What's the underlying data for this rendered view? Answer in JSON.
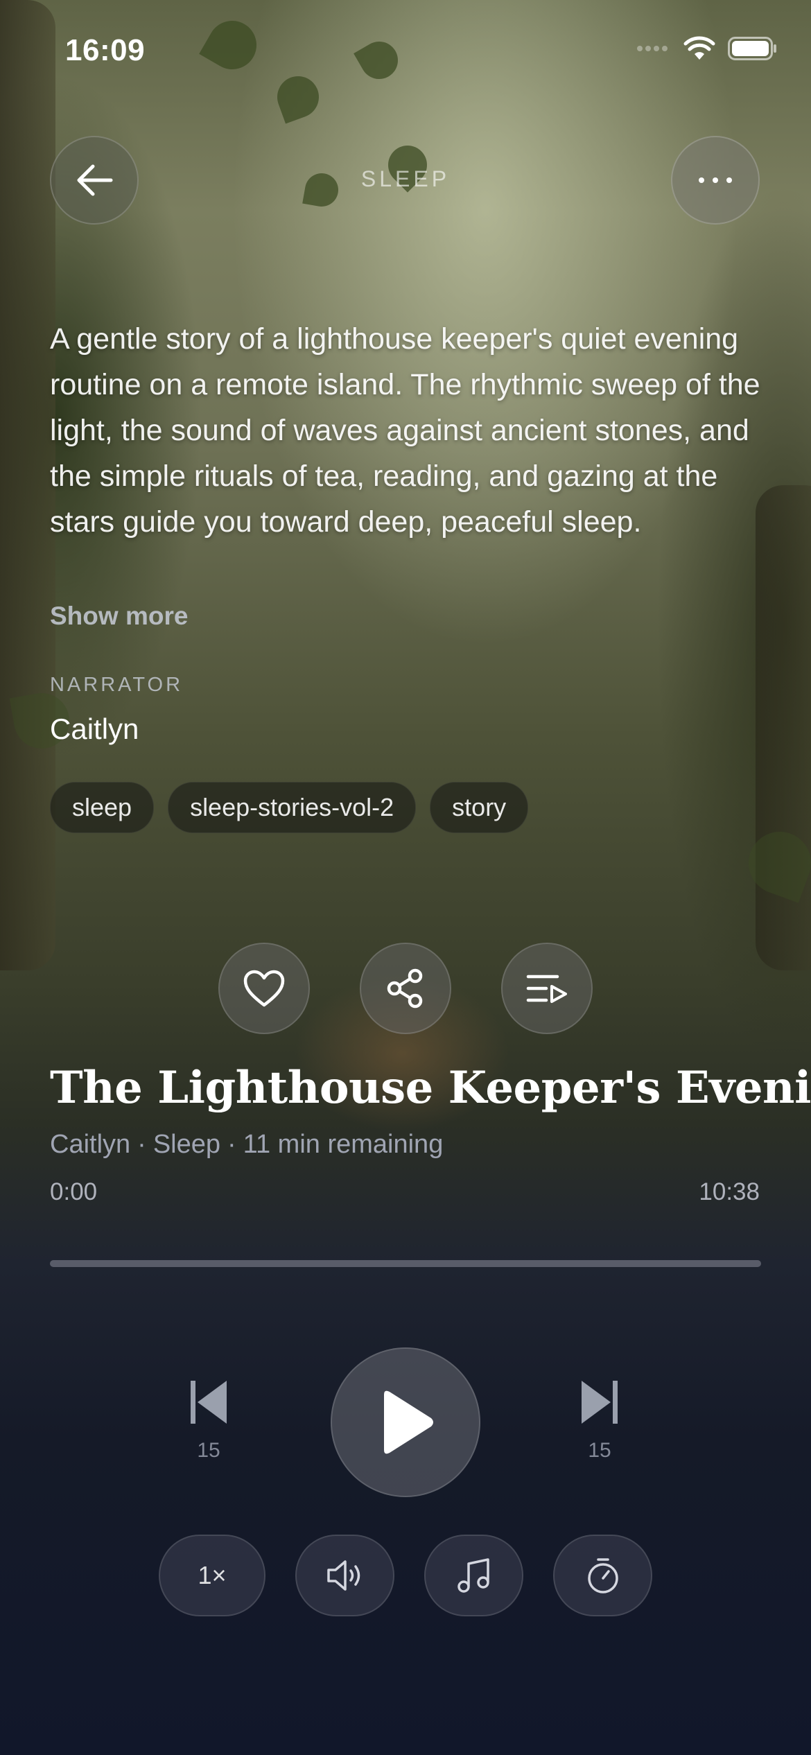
{
  "status_bar": {
    "time": "16:09"
  },
  "header": {
    "title": "SLEEP",
    "back_icon": "arrow-left-icon",
    "more_icon": "ellipsis-icon"
  },
  "description": {
    "text": "A gentle story of a lighthouse keeper's quiet evening routine on a remote island. The rhythmic sweep of the light, the sound of waves against ancient stones, and the simple rituals of tea, reading, and gazing at the stars guide you toward deep, peaceful sleep.",
    "show_more": "Show more"
  },
  "narrator": {
    "label": "NARRATOR",
    "name": "Caitlyn"
  },
  "tags": [
    "sleep",
    "sleep-stories-vol-2",
    "story"
  ],
  "actions": {
    "favorite_icon": "heart-icon",
    "share_icon": "share-icon",
    "queue_icon": "playlist-icon"
  },
  "track": {
    "title": "The Lighthouse Keeper's Evening",
    "narrator": "Caitlyn",
    "category": "Sleep",
    "remaining": "11 min remaining",
    "separator": "·",
    "current_time": "0:00",
    "total_time": "10:38",
    "progress": 0.0
  },
  "controls": {
    "skip_back_label": "15",
    "skip_forward_label": "15",
    "play_icon": "play-icon",
    "speed_label": "1×",
    "volume_icon": "speaker-icon",
    "music_icon": "music-note-icon",
    "timer_icon": "timer-icon"
  }
}
